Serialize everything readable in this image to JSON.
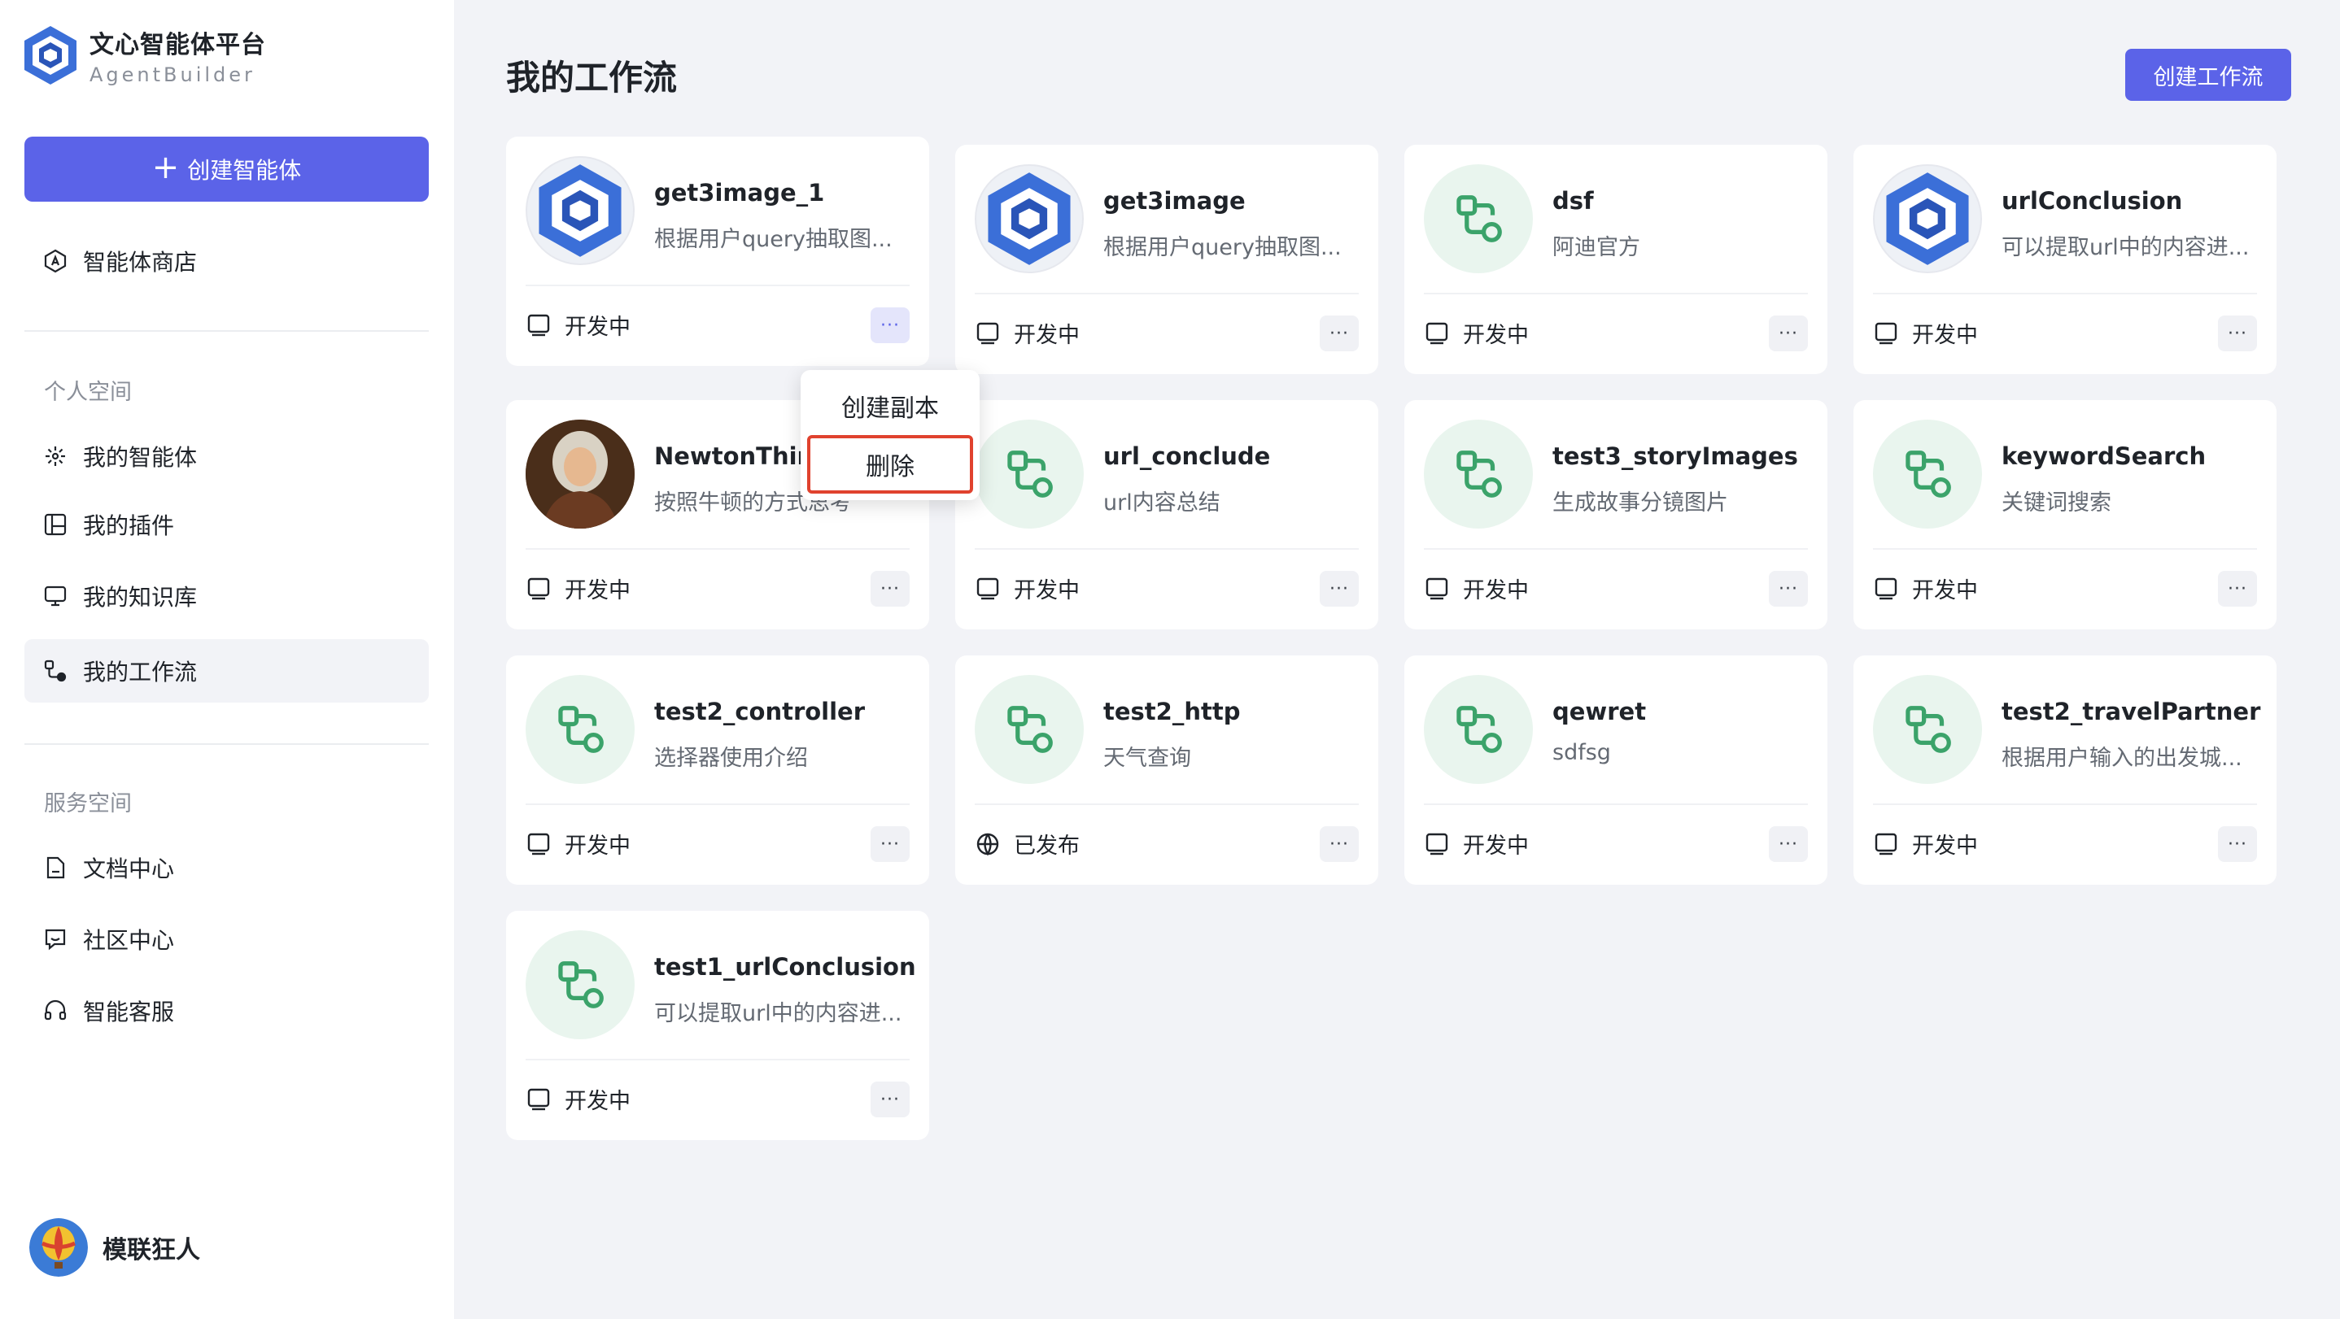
{
  "brand": {
    "name_cn": "文心智能体平台",
    "name_en": "AgentBuilder"
  },
  "sidebar": {
    "create_agent": "创建智能体",
    "store": "智能体商店",
    "personal_label": "个人空间",
    "personal_items": [
      {
        "label": "我的智能体",
        "icon": "sparkle-icon"
      },
      {
        "label": "我的插件",
        "icon": "plugin-icon"
      },
      {
        "label": "我的知识库",
        "icon": "monitor-icon"
      },
      {
        "label": "我的工作流",
        "icon": "workflow-icon"
      }
    ],
    "service_label": "服务空间",
    "service_items": [
      {
        "label": "文档中心",
        "icon": "document-icon"
      },
      {
        "label": "社区中心",
        "icon": "chat-icon"
      },
      {
        "label": "智能客服",
        "icon": "headset-icon"
      }
    ]
  },
  "user": {
    "name": "模联狂人"
  },
  "header": {
    "title": "我的工作流",
    "create_button": "创建工作流"
  },
  "workflows": [
    {
      "name": "get3image_1",
      "desc": "根据用户query抽取图...",
      "status": "开发中",
      "icon": "logo"
    },
    {
      "name": "get3image",
      "desc": "根据用户query抽取图...",
      "status": "开发中",
      "icon": "logo"
    },
    {
      "name": "dsf",
      "desc": "阿迪官方",
      "status": "开发中",
      "icon": "workflow"
    },
    {
      "name": "urlConclusion",
      "desc": "可以提取url中的内容进...",
      "status": "开发中",
      "icon": "logo"
    },
    {
      "name": "NewtonThink",
      "desc": "按照牛顿的方式思考",
      "status": "开发中",
      "icon": "portrait"
    },
    {
      "name": "url_conclude",
      "desc": "url内容总结",
      "status": "开发中",
      "icon": "workflow"
    },
    {
      "name": "test3_storyImages",
      "desc": "生成故事分镜图片",
      "status": "开发中",
      "icon": "workflow"
    },
    {
      "name": "keywordSearch",
      "desc": "关键词搜索",
      "status": "开发中",
      "icon": "workflow"
    },
    {
      "name": "test2_controller",
      "desc": "选择器使用介绍",
      "status": "开发中",
      "icon": "workflow"
    },
    {
      "name": "test2_http",
      "desc": "天气查询",
      "status": "已发布",
      "icon": "workflow"
    },
    {
      "name": "qewret",
      "desc": "sdfsg",
      "status": "开发中",
      "icon": "workflow"
    },
    {
      "name": "test2_travelPartner",
      "desc": "根据用户输入的出发城...",
      "status": "开发中",
      "icon": "workflow"
    },
    {
      "name": "test1_urlConclusion",
      "desc": "可以提取url中的内容进...",
      "status": "开发中",
      "icon": "workflow"
    }
  ],
  "context_menu": {
    "copy": "创建副本",
    "delete": "删除"
  },
  "more_glyph": "···",
  "colors": {
    "accent": "#5b63e8",
    "workflow_green": "#3ba36a",
    "highlight": "#e0422e"
  }
}
